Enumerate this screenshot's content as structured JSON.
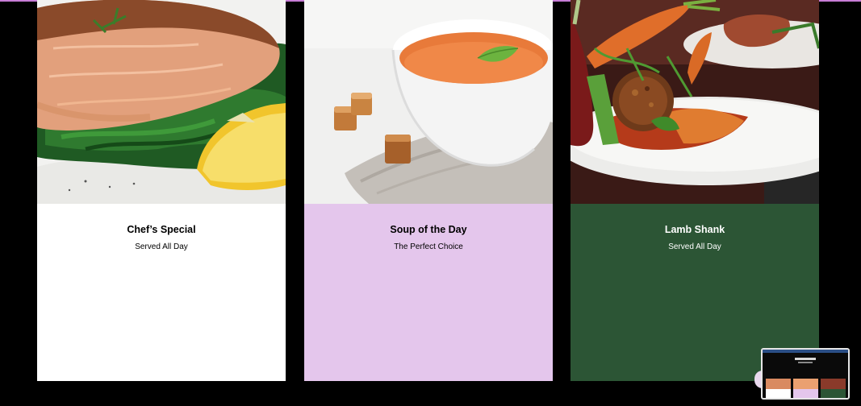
{
  "cards": [
    {
      "title": "Chef’s Special",
      "subtitle": "Served All Day",
      "image_icon": "salmon-dish-icon",
      "bg": "#ffffff",
      "fg": "#000000"
    },
    {
      "title": "Soup of the Day",
      "subtitle": "The Perfect Choice",
      "image_icon": "soup-bowl-icon",
      "bg": "#e4c6ec",
      "fg": "#000000"
    },
    {
      "title": "Lamb Shank",
      "subtitle": "Served All Day",
      "image_icon": "lamb-plate-icon",
      "bg": "#2c5535",
      "fg": "#ffffff"
    }
  ],
  "colors": {
    "page_bg": "#000000",
    "accent": "#c77dd6"
  }
}
